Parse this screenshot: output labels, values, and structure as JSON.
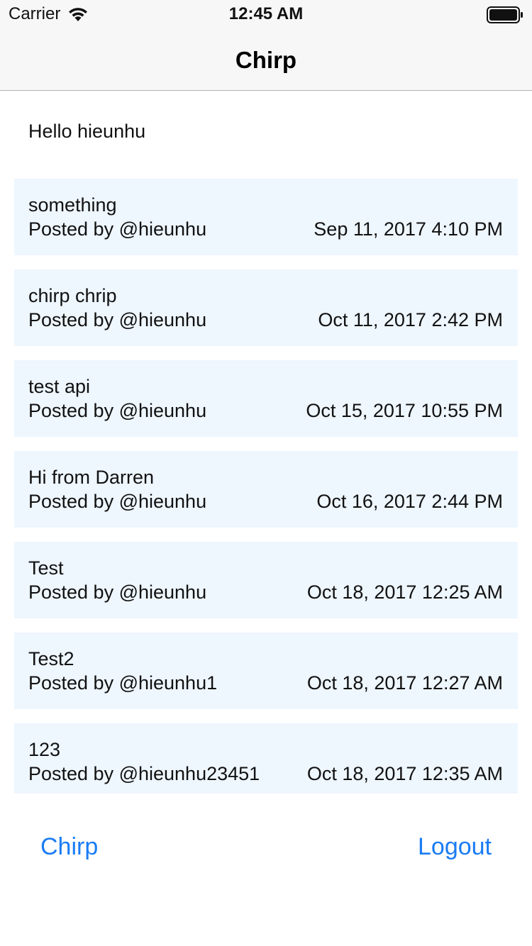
{
  "status_bar": {
    "carrier": "Carrier",
    "time": "12:45 AM",
    "wifi_icon": "wifi-icon",
    "battery_icon": "battery-icon"
  },
  "nav": {
    "title": "Chirp"
  },
  "greeting": "Hello hieunhu",
  "posts": [
    {
      "text": "something",
      "author": "Posted by @hieunhu",
      "date": "Sep 11, 2017 4:10 PM"
    },
    {
      "text": "chirp chrip",
      "author": "Posted by @hieunhu",
      "date": "Oct 11, 2017 2:42 PM"
    },
    {
      "text": "test api",
      "author": "Posted by @hieunhu",
      "date": "Oct 15, 2017 10:55 PM"
    },
    {
      "text": "Hi from Darren",
      "author": "Posted by @hieunhu",
      "date": "Oct 16, 2017 2:44 PM"
    },
    {
      "text": "Test",
      "author": "Posted by @hieunhu",
      "date": "Oct 18, 2017 12:25 AM"
    },
    {
      "text": "Test2",
      "author": "Posted by @hieunhu1",
      "date": "Oct 18, 2017 12:27 AM"
    },
    {
      "text": "123",
      "author": "Posted by @hieunhu23451",
      "date": "Oct 18, 2017 12:35 AM"
    }
  ],
  "bottom": {
    "chirp_label": "Chirp",
    "logout_label": "Logout"
  },
  "colors": {
    "accent": "#1a7cf5",
    "card_background": "#eef6fe",
    "bar_background": "#f7f7f7"
  }
}
